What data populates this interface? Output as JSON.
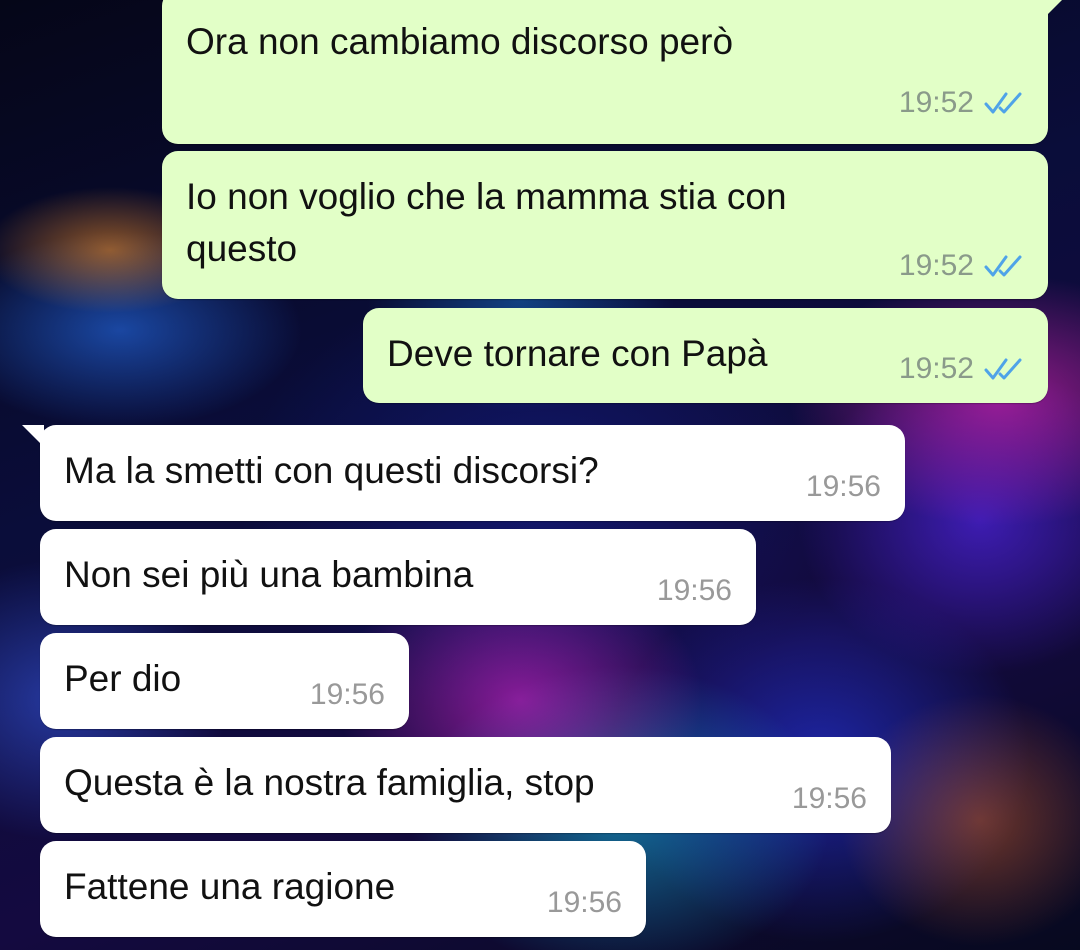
{
  "colors": {
    "outgoing_bubble": "#e2ffc7",
    "incoming_bubble": "#ffffff",
    "read_ticks": "#4fa3e8"
  },
  "icons": {
    "read_receipt": "double-check-icon"
  },
  "messages": [
    {
      "direction": "outgoing",
      "text": "Ora non cambiamo discorso però",
      "time": "19:52",
      "status": "read"
    },
    {
      "direction": "outgoing",
      "text": "Io non voglio che la mamma stia con\nquesto",
      "time": "19:52",
      "status": "read"
    },
    {
      "direction": "outgoing",
      "text": "Deve tornare con Papà",
      "time": "19:52",
      "status": "read"
    },
    {
      "direction": "incoming",
      "text": "Ma la smetti con questi discorsi?",
      "time": "19:56"
    },
    {
      "direction": "incoming",
      "text": "Non sei più una bambina",
      "time": "19:56"
    },
    {
      "direction": "incoming",
      "text": "Per dio",
      "time": "19:56"
    },
    {
      "direction": "incoming",
      "text": "Questa è la nostra famiglia, stop",
      "time": "19:56"
    },
    {
      "direction": "incoming",
      "text": "Fattene una ragione",
      "time": "19:56"
    }
  ]
}
